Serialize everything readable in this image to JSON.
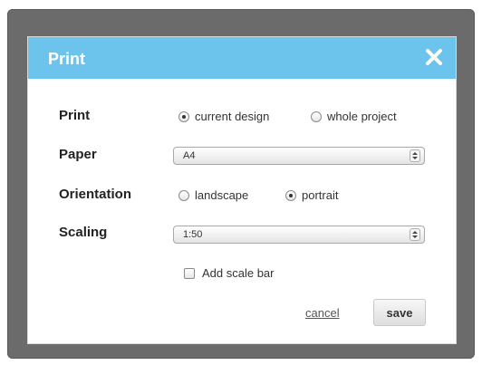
{
  "dialog": {
    "title": "Print",
    "close_icon": "close-icon",
    "accent_color": "#6cc3ec"
  },
  "print": {
    "label": "Print",
    "options": [
      {
        "label": "current design",
        "checked": true
      },
      {
        "label": "whole project",
        "checked": false
      }
    ]
  },
  "paper": {
    "label": "Paper",
    "selected": "A4"
  },
  "orientation": {
    "label": "Orientation",
    "options": [
      {
        "label": "landscape",
        "checked": false
      },
      {
        "label": "portrait",
        "checked": true
      }
    ]
  },
  "scaling": {
    "label": "Scaling",
    "selected": "1:50"
  },
  "scale_bar": {
    "label": "Add scale bar",
    "checked": false
  },
  "actions": {
    "cancel_label": "cancel",
    "save_label": "save"
  }
}
